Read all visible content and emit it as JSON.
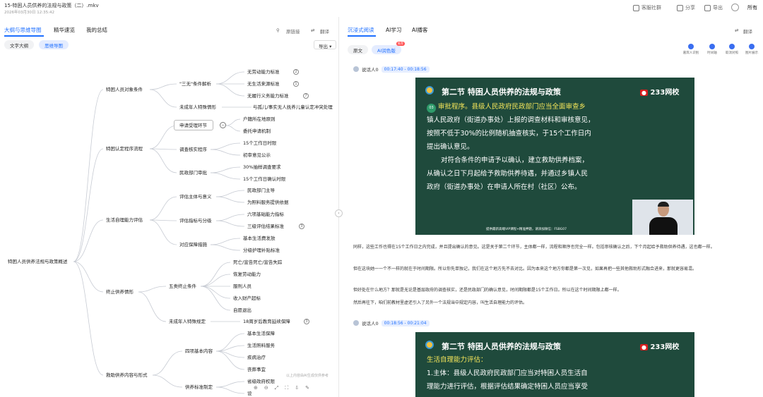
{
  "titlebar": {
    "title": "15-特困人员供养的法规与政策（二）.mkv",
    "datetime": "2026年03月30日 12:35:42",
    "actions": [
      "客服社群",
      "分享",
      "导出"
    ],
    "more": "所有"
  },
  "left": {
    "tabs": [
      "大纲与思维导图",
      "精华速览",
      "我的总结"
    ],
    "original_link": "原链接",
    "translate": "翻译",
    "subtabs": [
      "文字大纲",
      "思维导图"
    ],
    "export": "导出",
    "ai_note": "以上内容由AI生成仅供参考",
    "mindmap": {
      "root": "特困人员供养法规与政策概述",
      "b1": "特困人员对象条件",
      "b1_1": "\"三无\"条件解析",
      "b1_1a": "无劳动能力标准",
      "b1_1b": "无生活来源标准",
      "b1_1c": "无履行义务能力标准",
      "b1_2": "未成年人特殊情形",
      "b1_2a": "与孤儿/事实无人抚养儿童认定冲突处理",
      "b2": "特困认定程序流程",
      "b2_1": "申请受理环节",
      "b2_1a": "户籍所在地原则",
      "b2_1b": "委托申请机制",
      "b2_2": "调查核实程序",
      "b2_2a": "15个工作日时限",
      "b2_2b": "初审意见公示",
      "b2_3": "民政部门审批",
      "b2_3a": "30%抽样调查要求",
      "b2_3b": "15个工作日确认时限",
      "b3": "生活自理能力评估",
      "b3_1": "评估主体与意义",
      "b3_1a": "民政部门主导",
      "b3_1b": "为照料服务提供依据",
      "b3_2": "评估指标与分级",
      "b3_2a": "六项基础能力指标",
      "b3_2b": "三级评估结果标准",
      "b3_3": "对应保障措施",
      "b3_3a": "基本生活费发放",
      "b3_3b": "分级护理补贴标准",
      "b4": "终止供养情形",
      "b4_1": "五类终止条件",
      "b4_1a": "死亡/宣告死亡/宣告失踪",
      "b4_1b": "恢复劳动能力",
      "b4_1c": "服刑人员",
      "b4_1d": "收入财产超标",
      "b4_1e": "自愿退出",
      "b4_2": "未成年人特殊规定",
      "b4_2a": "18周岁后教育延续保障",
      "b5": "救助供养内容与形式",
      "b5_1": "四项基本内容",
      "b5_1a": "基本生活保障",
      "b5_1b": "生活照料服务",
      "b5_1c": "疾病治疗",
      "b5_1d": "丧葬事宜",
      "b5_2": "供养标准制定",
      "b5_2a": "省级政府权限",
      "b5_2b": "设",
      "badges": [
        "2",
        "1",
        "7",
        "3",
        "3"
      ]
    }
  },
  "right": {
    "tabs": [
      "沉浸式阅读",
      "AI学习",
      "AI播客"
    ],
    "translate": "翻译",
    "subtabs": [
      "原文",
      "AI润色版"
    ],
    "badge_new": "推荐",
    "icon_tools": [
      "嘉宾人识别",
      "时间轴",
      "取消对照",
      "图片展示"
    ],
    "segments": [
      {
        "speaker": "说话人0",
        "time": "00:17:40 - 00:18:56"
      },
      {
        "speaker": "说话人0",
        "time": "00:18:56 - 00:21:04"
      }
    ],
    "slide1": {
      "title": "第二节  特困人员供养的法规与政策",
      "logo": "233网校",
      "num": "03",
      "lines": [
        "审批程序。县级人民政府民政部门应当全面审查乡",
        "镇人民政府（街道办事处）上报的调查材料和审核意见，",
        "按照不低于30%的比例随机抽查核实，于15个工作日内",
        "提出确认意见。",
        "对符合条件的申请予以确认，建立救助供养档案，",
        "从确认之日下月起给予救助供养待遇，并通过乡镇人民",
        "政府（街道办事处）在申请人所在村（社区）公布。"
      ],
      "footer": "提供最新高端VIP课程+精准押题，请添加微信：FSBG07"
    },
    "slide2": {
      "title": "第二节  特困人员供养的法规与政策",
      "logo": "233网校",
      "lines": [
        "生活自理能力评估：",
        "1.主体：县级人民政府民政部门应当对特困人员生活自",
        "理能力进行评估，根据评估结果确定特困人员应当享受"
      ]
    },
    "paragraphs": [
      "同样，这些工作也得在15个工作日之内完成，并且提出确认的意见。这是关于第二个环节，主体都一样，流程和顺序也完全一样。包括审核确认之后，下个月起给予救助供养待遇，这也都一样。",
      "但在这块她一一个不一样的就在于时间期限。所以你先单独记，我们在这个地方先不去对比。因为本来这个地方你都是第一次见，如果再把一些其他救助形式融合进来，那就更容易混。",
      "但好处在什么地方？那就是无论是基层政府的调查核实，还是民政部门的确认意见，时间期限都是15个工作日。所以在这个时间期限上都一样。",
      "然后再往下，咱们前教材里虚还引入了另外一个法规当中规定内容，叫生活自理能力的评估。"
    ]
  }
}
